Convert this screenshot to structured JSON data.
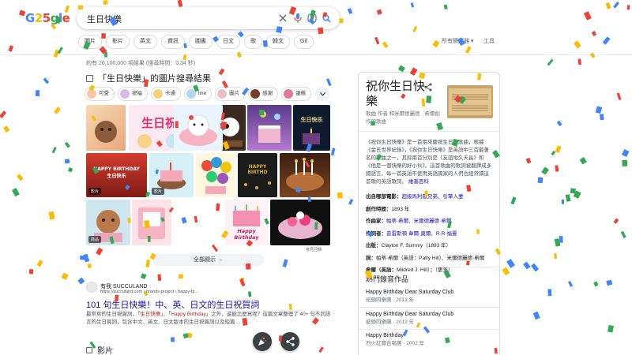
{
  "header": {
    "search_query": "生日快樂",
    "filters": [
      "圖片",
      "影片",
      "英文",
      "資訊",
      "圖書",
      "日文",
      "歌",
      "韓文",
      "Gif"
    ],
    "settings_label": "所有篩選器",
    "tools_label": "工具"
  },
  "stats": "約有 26,100,000 項結果 (搜尋時間：0.34 秒)",
  "images": {
    "heading": "「生日快樂」的圖片搜尋結果",
    "chips": [
      "可愛",
      "祝福",
      "卡通",
      "line",
      "圖片",
      "感謝",
      "蛋糕"
    ],
    "badges": [
      "影片",
      "影片",
      "商品"
    ],
    "tile_captions": [
      "生日祝",
      "生日快乐",
      "HAPPY BIRTHDAY 生日快乐",
      "HAPPY BIRTHD",
      "Happy Birthday"
    ],
    "feedback": "意見回饋",
    "see_all": "全部顯示"
  },
  "result": {
    "site": "有我 SUCCULAND",
    "url": "https://succuland.com › brands-project › happy-bi...",
    "title": "101 句生日快樂！中、英、日文的生日祝賀詞",
    "snippet_pre": "最常見的生日祝賀詞，「",
    "snippet_em1": "生日快樂",
    "snippet_mid": "」、「",
    "snippet_em2": "Happy Birthday",
    "snippet_post": "」之外，還能怎麼寫呢？這篇文章整理了 40+ 句不同語言的生日賀詞，包含中文、英文、日文版本的生日祝賀詞以及短篇 ..."
  },
  "videos": {
    "heading": "影片"
  },
  "panel": {
    "title": "祝你生日快樂",
    "subtitle": "歌曲 作者 和米爾德麗德 · 希爾創作的歌曲",
    "description": "《祝你生日快樂》是一首用來慶祝生日的歌曲，根據《金氏世界紀錄》，《祝你生日快樂》是英語中三首最著名的歌曲之一，其餘兩首分別是《友誼地久天長》和《他是一個快樂的好小伙》。這首歌曲的歌詞被翻譯成多國語言，每一首英語不使用英語國家的人們也經常讀這首歌的英語歌詞。",
    "desc_link": "維基百科",
    "facts": [
      {
        "label": "出自哪部電影：",
        "value": "超級馬利歐兄弟、引擎人妻"
      },
      {
        "label": "創作時間：",
        "value": "1893 年"
      },
      {
        "label": "作曲家：",
        "value": "帕蒂·希爾、米爾德麗德·希爾"
      },
      {
        "label": "作詞者：",
        "value": "普雷斯頓·韋爾·奧爾、R·R·福曼"
      },
      {
        "label": "出版：",
        "value": "Clayton F. Summy（1893 年）"
      },
      {
        "label": "詞：",
        "value": "帕蒂·希爾（英語：Patty Hill）、米爾德麗德·希爾"
      },
      {
        "label": "希爾（英語：",
        "value": "Mildred J. Hill）；（更多）"
      }
    ],
    "songs_heading": "熱門錄音作品",
    "songs": [
      {
        "title": "Happy Birthday Dear Saturday Club",
        "sub": "班頭四樂團 · 2013 年"
      },
      {
        "title": "Happy Birthday Dear Saturday Club",
        "sub": "披頭四樂團 · 2013 年"
      },
      {
        "title": "Happy Birthday",
        "sub": "烈火紅寶合唱團 · 2002 年"
      }
    ]
  },
  "colors": {
    "link": "#1a0dab",
    "confetti": [
      "#4285f4",
      "#ea4335",
      "#fbbc05",
      "#34a853"
    ]
  }
}
